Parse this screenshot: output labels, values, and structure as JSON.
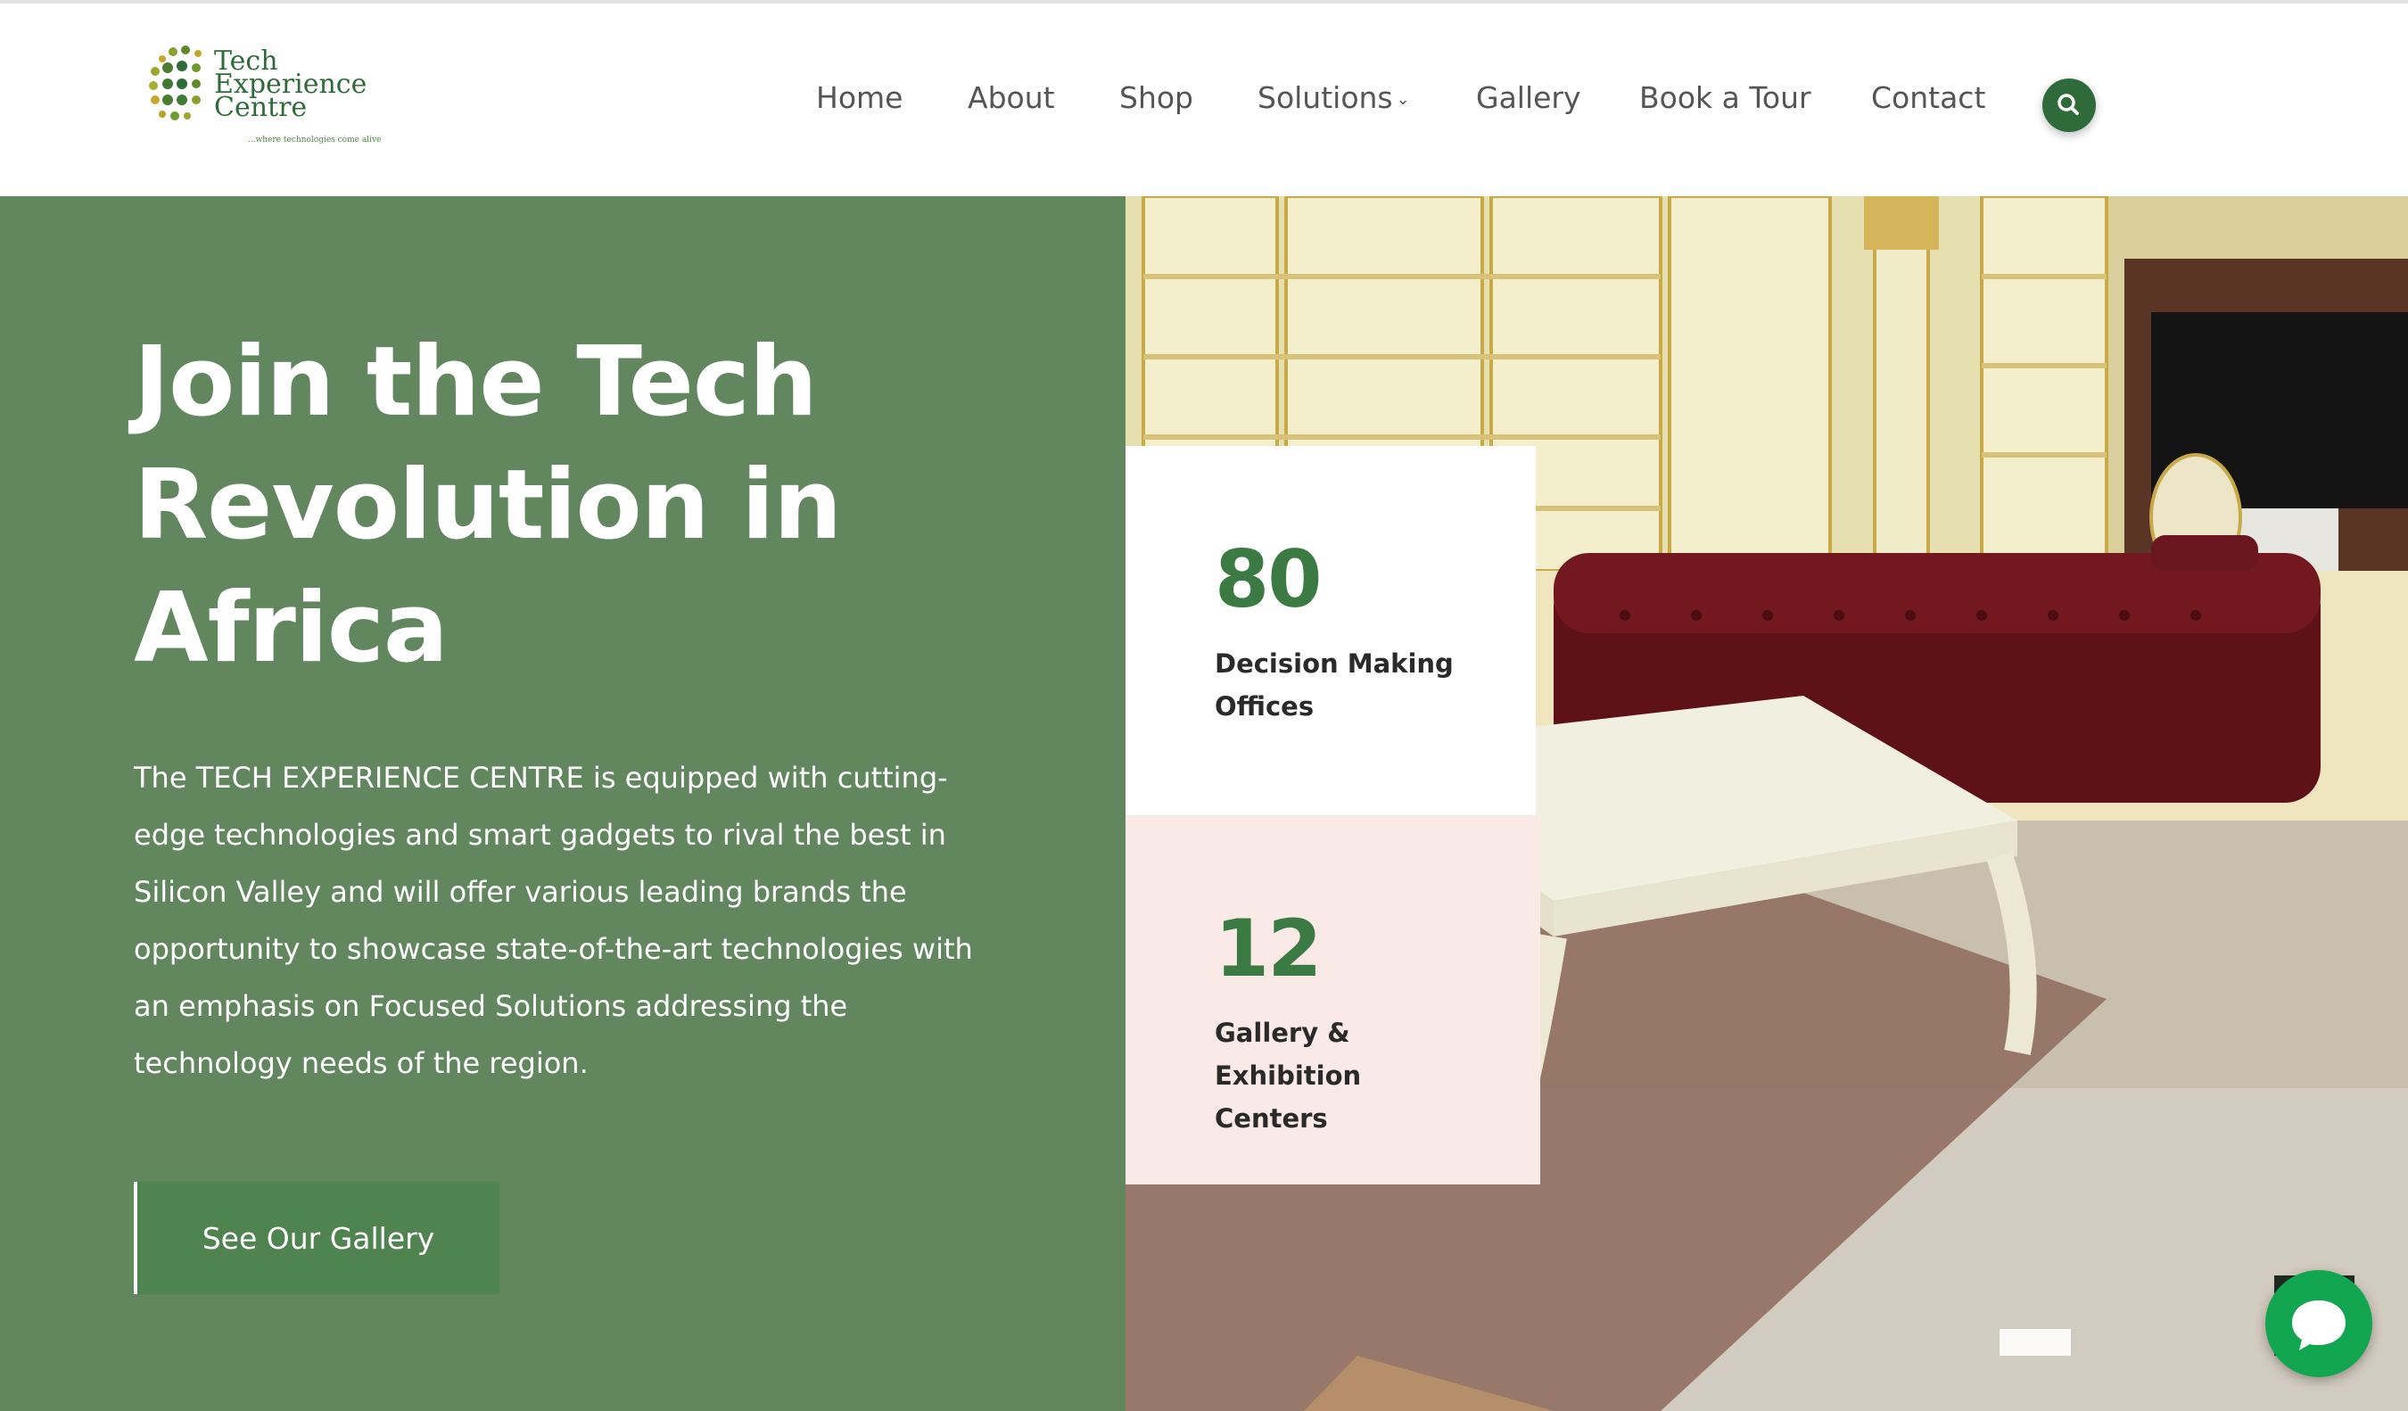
{
  "brand": {
    "name_line1": "Tech",
    "name_line2": "Experience",
    "name_line3": "Centre",
    "tagline": "...where technologies come alive",
    "colors": {
      "primary": "#2f6b3a",
      "hero_bg": "#62875f",
      "button": "#4f8350",
      "accent_pink": "#f9e9e7",
      "chat": "#13a650"
    }
  },
  "nav": {
    "items": [
      {
        "label": "Home"
      },
      {
        "label": "About"
      },
      {
        "label": "Shop"
      },
      {
        "label": "Solutions",
        "has_dropdown": true
      },
      {
        "label": "Gallery"
      },
      {
        "label": "Book a Tour"
      },
      {
        "label": "Contact"
      }
    ],
    "search_icon": "search-icon"
  },
  "hero": {
    "title_line1": "Join the Tech",
    "title_line2": "Revolution in",
    "title_line3": "Africa",
    "body": "The TECH EXPERIENCE CENTRE is equipped with cutting-edge technologies and smart gadgets to rival the best in Silicon Valley and will offer various leading brands the opportunity to showcase state-of-the-art technologies with an emphasis on Focused Solutions addressing the technology needs of the region.",
    "cta_label": "See Our Gallery"
  },
  "stats": [
    {
      "value": "80",
      "label": "Decision Making Offices"
    },
    {
      "value": "12",
      "label": "Gallery & Exhibition Centers"
    }
  ],
  "chat": {
    "icon": "chat-bubble-icon"
  }
}
